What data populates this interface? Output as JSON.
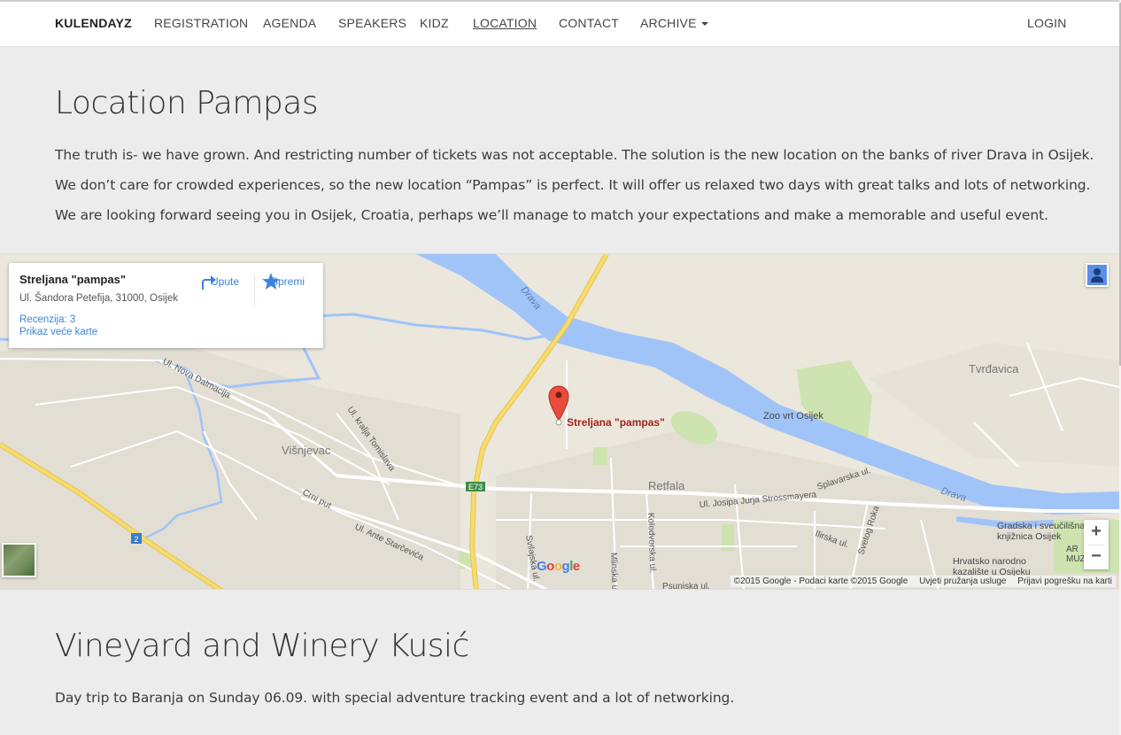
{
  "nav": {
    "brand": "KULENDAYZ",
    "items": [
      "REGISTRATION",
      "AGENDA",
      "SPEAKERS",
      "KIDZ",
      "LOCATION",
      "CONTACT",
      "ARCHIVE"
    ],
    "active": "LOCATION",
    "login": "LOGIN"
  },
  "section1": {
    "title": "Location Pampas",
    "paragraphs": [
      "The truth is- we have grown. And restricting number of tickets was not acceptable. The solution is the new location on the banks of river Drava in Osijek.",
      "We don’t care for crowded experiences, so the new location “Pampas” is perfect. It will offer us relaxed two days with great talks and lots of networking.",
      "We are looking forward seeing you in Osijek, Croatia, perhaps we’ll manage to match your expectations and make a memorable and useful event."
    ]
  },
  "map": {
    "place_name": "Streljana \"pampas\"",
    "place_address": "Ul. Šandora Petefija, 31000, Osijek",
    "reviews": "Recenzija: 3",
    "larger_map": "Prikaz veće karte",
    "directions": "Upute",
    "save": "Spremi",
    "marker_label": "Streljana \"pampas\"",
    "labels": {
      "drava1": "Drava",
      "drava2": "Drava",
      "tvrdavica": "Tvrđavica",
      "zoo": "Zoo vrt Osijek",
      "nova_dalmacija": "Ul. Nova Dalmacija",
      "kralja_tomislava": "Ul. kralja Tomislava",
      "visnjevac": "Višnjevac",
      "crni_put": "Crni put",
      "ante_starcevica": "Ul. Ante Starčevića",
      "retfala": "Retfala",
      "strossmayera": "Ul. Josipa Jurja Strossmayera",
      "splavarska": "Splavarska ul.",
      "e73": "E73",
      "route2": "2",
      "svilajska": "Svilajska ul.",
      "mlinska": "Mlinska ul.",
      "kolodvorska": "Kolodvorska ul.",
      "psunjska": "Psunjska ul.",
      "ilirska": "Ilirska ul.",
      "svetog_roka": "Svetog Roka",
      "knjiznica": "Gradska i sveučilišna knjižnica Osijek",
      "knjiznica_l1": "Gradska i sveučilišna",
      "knjiznica_l2": "knjižnica Osijek",
      "kazaliste_l1": "Hrvatsko narodno",
      "kazaliste_l2": "kazalište u Osijeku",
      "ar": "AR",
      "muz": "MUZ",
      "google": "Google"
    },
    "footer": {
      "copyright": "©2015 Google - Podaci karte ©2015 Google",
      "terms": "Uvjeti pružanja usluge",
      "report": "Prijavi pogrešku na karti"
    },
    "zoom_in": "+",
    "zoom_out": "−",
    "colors": {
      "river": "#a0c4f8",
      "highway": "#f2d45c",
      "park": "#cde3b0",
      "land": "#ebe7dd",
      "urban": "#e0dcd2",
      "marker": "#e74c3c"
    }
  },
  "section2": {
    "title": "Vineyard and Winery Kusić",
    "paragraph": "Day trip to Baranja on Sunday 06.09. with special adventure tracking event and a lot of networking."
  }
}
